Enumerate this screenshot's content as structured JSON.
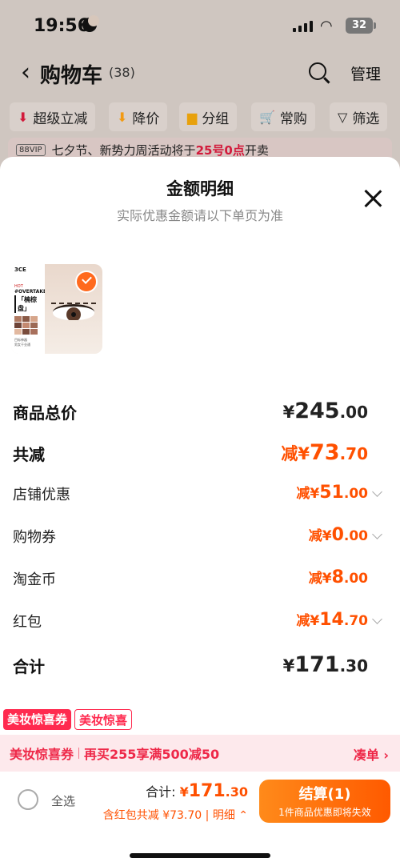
{
  "status": {
    "time": "19:56",
    "battery": "32"
  },
  "header": {
    "title": "购物车",
    "count": "(38)",
    "manage": "管理"
  },
  "filters": [
    {
      "label": "超级立减",
      "icon": "down-arrow-red-icon"
    },
    {
      "label": "降价",
      "icon": "down-arrow-orange-icon"
    },
    {
      "label": "分组",
      "icon": "folder-icon"
    },
    {
      "label": "常购",
      "icon": "cart-icon"
    },
    {
      "label": "筛选",
      "icon": "filter-icon"
    }
  ],
  "notice": {
    "badge": "88VIP",
    "text_before": "七夕节、新势力周活动将于",
    "highlight": "25号0点",
    "text_after": "开卖"
  },
  "sheet": {
    "title": "金额明细",
    "subtitle": "实际优惠金额请以下单页为准"
  },
  "product": {
    "brand": "3CE",
    "hot": "HOT",
    "line1": "#OVERTAKE",
    "name": "「楠棕盘」",
    "swatches": [
      "#b07a62",
      "#8a5a46",
      "#d6a58a",
      "#6e4437",
      "#c48a70",
      "#9c6a56",
      "#e2b9a0",
      "#7a4c3c",
      "#a8705c"
    ],
    "small1": "目标神器",
    "small2": "男女干业通"
  },
  "rows": {
    "total": {
      "label": "商品总价",
      "prefix": "¥",
      "int": "245",
      "dec": ".00"
    },
    "saved": {
      "label": "共减",
      "prefix": "减¥",
      "int": "73",
      "dec": ".70"
    },
    "shop": {
      "label": "店铺优惠",
      "prefix": "减¥",
      "int": "51",
      "dec": ".00"
    },
    "voucher": {
      "label": "购物券",
      "prefix": "减¥",
      "int": "0",
      "dec": ".00"
    },
    "coin": {
      "label": "淘金币",
      "prefix": "减¥",
      "int": "8",
      "dec": ".00"
    },
    "redpacket": {
      "label": "红包",
      "prefix": "减¥",
      "int": "14",
      "dec": ".70"
    },
    "sum": {
      "label": "合计",
      "prefix": "¥",
      "int": "171",
      "dec": ".30"
    }
  },
  "coupon_tags": {
    "solid": "美妆惊喜券",
    "outline": "美妆惊喜"
  },
  "promo": {
    "name": "美妆惊喜券",
    "text": "再买255享满500减50",
    "link": "凑单 ›"
  },
  "bottom": {
    "select_all": "全选",
    "total_label": "合计: ",
    "total_prefix": "¥",
    "total_int": "171",
    "total_dec": ".30",
    "discount": "含红包共减 ¥73.70 | 明细 ⌃",
    "checkout": "结算(1)",
    "checkout_sub": "1件商品优惠即将失效"
  },
  "colors": {
    "accent": "#ff5000",
    "promo": "#ee2848",
    "checkout": "#ff6a00"
  }
}
